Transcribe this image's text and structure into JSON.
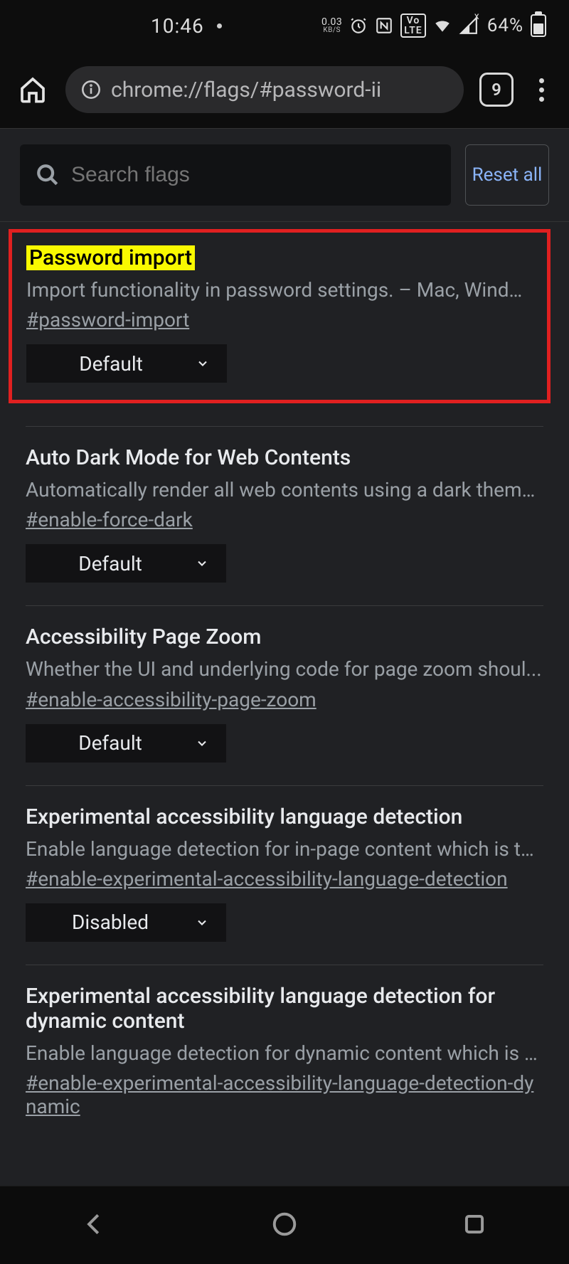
{
  "status": {
    "time": "10:46",
    "net_speed": "0.03",
    "net_speed_unit": "KB/S",
    "lte_badge": "Vo\nLTE",
    "battery_pct": "64%"
  },
  "browser": {
    "url": "chrome://flags/#password-ii",
    "tab_count": "9"
  },
  "search": {
    "placeholder": "Search flags",
    "reset_label": "Reset all"
  },
  "flags": [
    {
      "title": "Password import",
      "highlight": true,
      "desc": "Import functionality in password settings. – Mac, Windows...",
      "anchor": "#password-import",
      "select": "Default"
    },
    {
      "title": "Auto Dark Mode for Web Contents",
      "desc": "Automatically render all web contents using a dark theme....",
      "anchor": "#enable-force-dark",
      "select": "Default"
    },
    {
      "title": "Accessibility Page Zoom",
      "desc": "Whether the UI and underlying code for page zoom shoul...",
      "anchor": "#enable-accessibility-page-zoom",
      "select": "Default"
    },
    {
      "title": "Experimental accessibility language detection",
      "desc": "Enable language detection for in-page content which is th...",
      "anchor": "#enable-experimental-accessibility-language-detection",
      "select": "Disabled"
    },
    {
      "title": "Experimental accessibility language detection for dynamic content",
      "desc": "Enable language detection for dynamic content which is t...",
      "anchor": "#enable-experimental-accessibility-language-detection-dynamic",
      "select": ""
    }
  ]
}
